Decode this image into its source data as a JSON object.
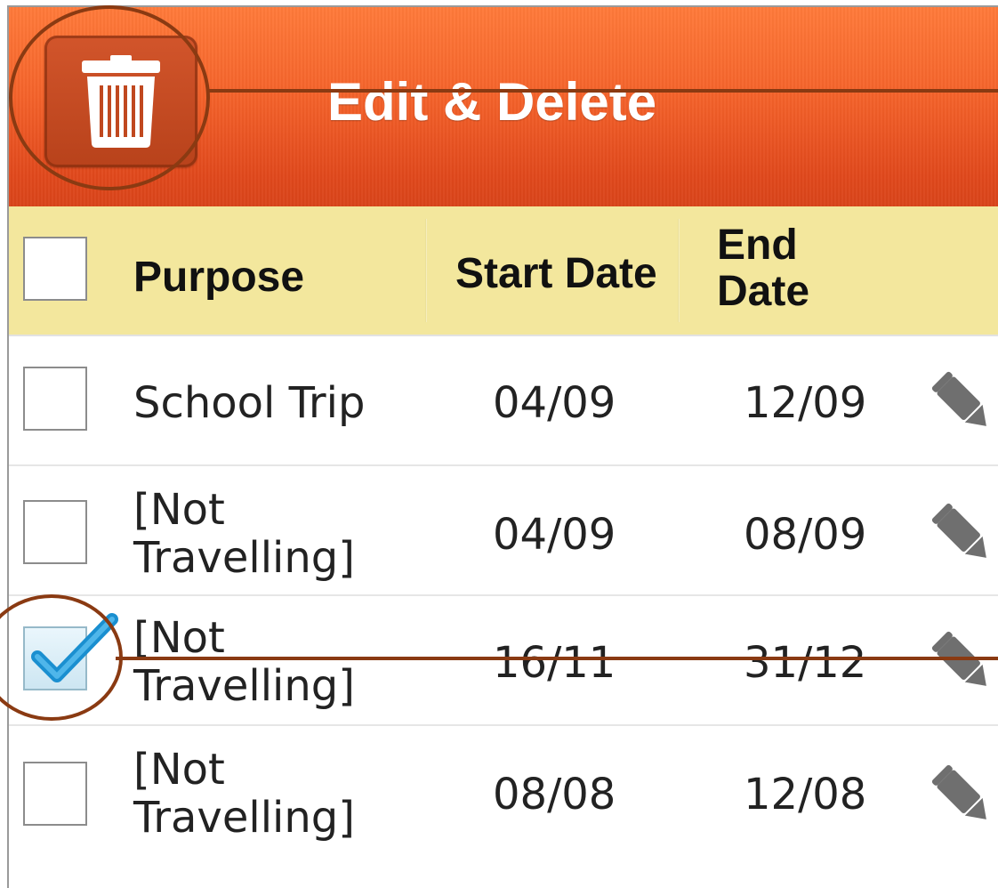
{
  "header": {
    "title": "Edit & Delete",
    "delete_icon": "trash-icon",
    "background_color": "#f4622a"
  },
  "columns": {
    "purpose": "Purpose",
    "start_date": "Start Date",
    "end_date_line1": "End",
    "end_date_line2": "Date",
    "header_background": "#f3e79d"
  },
  "rows": [
    {
      "purpose_line1": "School Trip",
      "purpose_line2": "",
      "start": "04/09",
      "end": "12/09",
      "checked": false
    },
    {
      "purpose_line1": "[Not",
      "purpose_line2": "Travelling]",
      "start": "04/09",
      "end": "08/09",
      "checked": false
    },
    {
      "purpose_line1": "[Not",
      "purpose_line2": "Travelling]",
      "start": "16/11",
      "end": "31/12",
      "checked": true
    },
    {
      "purpose_line1": "[Not",
      "purpose_line2": "Travelling]",
      "start": "08/08",
      "end": "12/08",
      "checked": false
    }
  ],
  "icons": {
    "row_action": "pencil-icon",
    "check": "checkmark-icon"
  },
  "annotation_color": "#8a3a12"
}
